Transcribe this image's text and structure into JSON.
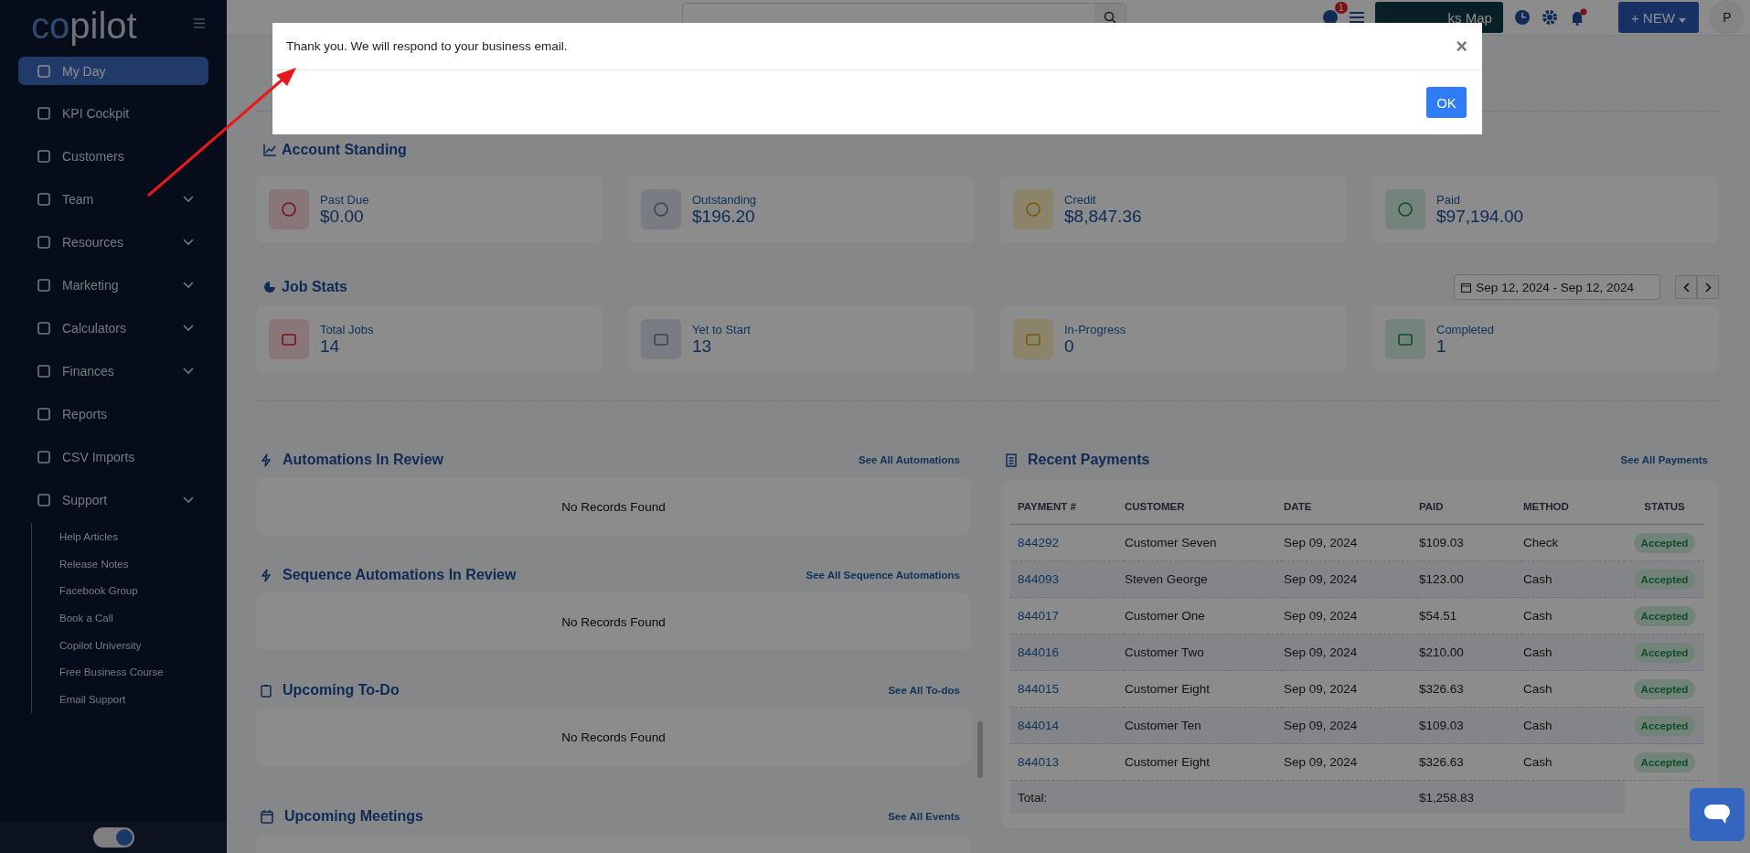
{
  "sidebar": {
    "logo_prefix": "co",
    "logo_suffix": "pilot",
    "items": [
      {
        "label": "My Day",
        "kind": "link",
        "selected": true
      },
      {
        "label": "KPI Cockpit",
        "kind": "link",
        "selected": false
      },
      {
        "label": "Customers",
        "kind": "link",
        "selected": false
      },
      {
        "label": "Team",
        "kind": "menu",
        "selected": false
      },
      {
        "label": "Resources",
        "kind": "menu",
        "selected": false
      },
      {
        "label": "Marketing",
        "kind": "menu",
        "selected": false
      },
      {
        "label": "Calculators",
        "kind": "menu",
        "selected": false
      },
      {
        "label": "Finances",
        "kind": "menu",
        "selected": false
      },
      {
        "label": "Reports",
        "kind": "link",
        "selected": false
      },
      {
        "label": "CSV Imports",
        "kind": "link",
        "selected": false
      },
      {
        "label": "Support",
        "kind": "menu",
        "selected": false,
        "children": [
          "Help Articles",
          "Release Notes",
          "Facebook Group",
          "Book a Call",
          "Copilot University",
          "Free Business Course",
          "Email Support"
        ]
      }
    ],
    "theme_toggle": {
      "on": true
    }
  },
  "header": {
    "notification_count": "1",
    "map_button": "ks Map",
    "new_button": "+ NEW",
    "avatar": "P"
  },
  "account_standing": {
    "title": "Account Standing",
    "cards": [
      {
        "label": "Past Due",
        "value": "$0.00",
        "kind": "danger"
      },
      {
        "label": "Outstanding",
        "value": "$196.20",
        "kind": "info"
      },
      {
        "label": "Credit",
        "value": "$8,847.36",
        "kind": "warning"
      },
      {
        "label": "Paid",
        "value": "$97,194.00",
        "kind": "success"
      }
    ]
  },
  "job_stats": {
    "title": "Job Stats",
    "date_range": "Sep 12, 2024 - Sep 12, 2024",
    "cards": [
      {
        "label": "Total Jobs",
        "value": "14",
        "kind": "danger"
      },
      {
        "label": "Yet to Start",
        "value": "13",
        "kind": "info"
      },
      {
        "label": "In-Progress",
        "value": "0",
        "kind": "warning"
      },
      {
        "label": "Completed",
        "value": "1",
        "kind": "success"
      }
    ]
  },
  "panels": [
    {
      "title": "Automations In Review",
      "link": "See All Automations",
      "empty_text": "No Records Found",
      "kind": "bolt"
    },
    {
      "title": "Sequence Automations In Review",
      "link": "See All Sequence Automations",
      "empty_text": "No Records Found",
      "kind": "bolt"
    },
    {
      "title": "Upcoming To-Do",
      "link": "See All To-dos",
      "empty_text": "No Records Found",
      "kind": "clipboard"
    },
    {
      "title": "Upcoming Meetings",
      "link": "See All Events",
      "kind": "calendar"
    }
  ],
  "payments": {
    "title": "Recent Payments",
    "link": "See All Payments",
    "columns": [
      "PAYMENT #",
      "CUSTOMER",
      "DATE",
      "PAID",
      "METHOD",
      "STATUS"
    ],
    "rows": [
      [
        "844292",
        "Customer Seven",
        "Sep 09, 2024",
        "$109.03",
        "Check",
        "Accepted"
      ],
      [
        "844093",
        "Steven George",
        "Sep 09, 2024",
        "$123.00",
        "Cash",
        "Accepted"
      ],
      [
        "844017",
        "Customer One",
        "Sep 09, 2024",
        "$54.51",
        "Cash",
        "Accepted"
      ],
      [
        "844016",
        "Customer Two",
        "Sep 09, 2024",
        "$210.00",
        "Cash",
        "Accepted"
      ],
      [
        "844015",
        "Customer Eight",
        "Sep 09, 2024",
        "$326.63",
        "Cash",
        "Accepted"
      ],
      [
        "844014",
        "Customer Ten",
        "Sep 09, 2024",
        "$109.03",
        "Cash",
        "Accepted"
      ],
      [
        "844013",
        "Customer Eight",
        "Sep 09, 2024",
        "$326.63",
        "Cash",
        "Accepted"
      ]
    ],
    "total_label": "Total:",
    "total_value": "$1,258.83"
  },
  "modal": {
    "message": "Thank you. We will respond to your business email.",
    "close": "×",
    "ok_button": "OK"
  }
}
